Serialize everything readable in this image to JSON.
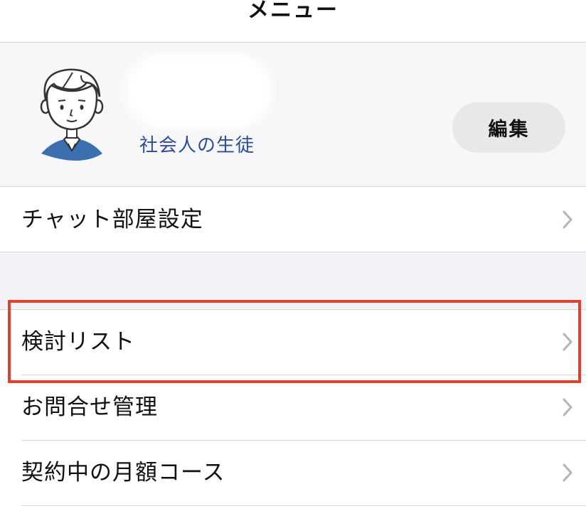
{
  "header": {
    "title": "メニュー"
  },
  "profile": {
    "role": "社会人の生徒",
    "edit_label": "編集"
  },
  "menu": {
    "chat_settings": "チャット部屋設定",
    "items": [
      {
        "label": "検討リスト",
        "highlighted": true
      },
      {
        "label": "お問合せ管理"
      },
      {
        "label": "契約中の月額コース"
      }
    ]
  },
  "colors": {
    "accent_text": "#2b4d99",
    "highlight": "#e0412e",
    "profile_bg": "#f7f7f9",
    "section_bg": "#f2f2f7",
    "avatar_shirt": "#3a6fb0"
  },
  "icons": {
    "chevron": "chevron-right-icon",
    "avatar": "student-avatar-icon"
  }
}
